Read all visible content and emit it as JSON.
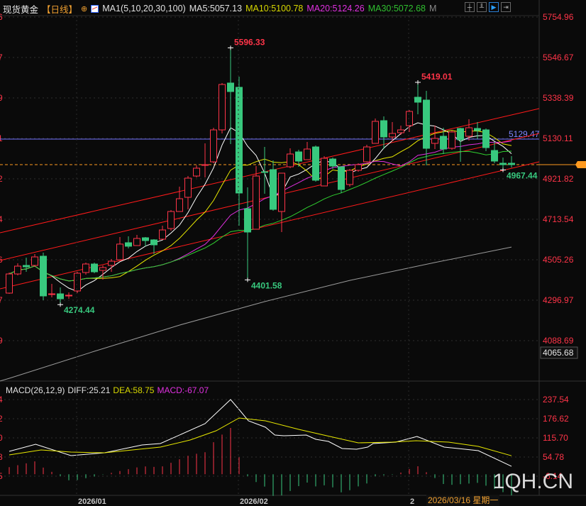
{
  "header": {
    "symbol": "现货黄金",
    "period": "【日线】",
    "indicator": "MA1(5,10,20,30,100)",
    "ma5": "MA5:5057.13",
    "ma10": "MA10:5100.78",
    "ma20": "MA20:5124.26",
    "ma30": "MA30:5072.68",
    "ma100_short": "M",
    "tools": [
      "crosshair-icon",
      "interval-icon",
      "play-icon",
      "exit-icon"
    ]
  },
  "macd_header": {
    "label": "MACD(26,12,9)",
    "diff": "DIFF:25.21",
    "dea": "DEA:58.75",
    "macd": "MACD:-67.07"
  },
  "colors": {
    "up": "#ff3448",
    "down": "#38c87e",
    "ma5": "#ffffff",
    "ma10": "#e8e800",
    "ma20": "#e030e0",
    "ma30": "#30d030",
    "ma100": "#9a9a9a",
    "trendline": "#ff1a1a",
    "hline": "#7070ff",
    "current_price": "#ff9a20",
    "axis_text": "#ff3448"
  },
  "watermark": "1QH.CN",
  "crosshair_date": "2026/03/16 星期一",
  "chart_data": [
    {
      "type": "candlestick",
      "title": "现货黄金 日线",
      "price_axis_labels": [
        "5754.96",
        "5546.67",
        "5338.39",
        "5130.11",
        "4921.82",
        "4713.54",
        "4505.26",
        "4296.97",
        "4088.69"
      ],
      "price_axis_min_box": "4065.68",
      "ylim": [
        4065.68,
        5754.96
      ],
      "left_axis_fragments": [
        "6",
        "7",
        "9",
        "1",
        "2",
        "4",
        "6",
        "7",
        "9"
      ],
      "date_axis_labels": [
        {
          "label": "2026/01",
          "index": 9
        },
        {
          "label": "2026/02",
          "index": 28
        },
        {
          "label": "2",
          "index": 48
        }
      ],
      "ohlc": [
        [
          4333.7,
          4439.7,
          4330.0,
          4432.3
        ],
        [
          4432.3,
          4487.1,
          4425.0,
          4472.5
        ],
        [
          4476.2,
          4516.2,
          4443.3,
          4468.9
        ],
        [
          4476.2,
          4534.6,
          4468.9,
          4520.0
        ],
        [
          4523.7,
          4541.9,
          4297.2,
          4319.1
        ],
        [
          4326.4,
          4381.2,
          4311.7,
          4330.0
        ],
        [
          4330.0,
          4362.9,
          4274.44,
          4304.4
        ],
        [
          4319.1,
          4337.4,
          4304.4,
          4322.8
        ],
        [
          4344.7,
          4443.3,
          4333.7,
          4436.0
        ],
        [
          4439.7,
          4490.8,
          4428.7,
          4483.5
        ],
        [
          4483.5,
          4490.8,
          4436.0,
          4443.3
        ],
        [
          4450.6,
          4476.2,
          4403.1,
          4465.2
        ],
        [
          4476.2,
          4509.1,
          4443.3,
          4498.1
        ],
        [
          4505.4,
          4622.3,
          4505.4,
          4586.0
        ],
        [
          4593.1,
          4626.0,
          4563.9,
          4574.9
        ],
        [
          4578.5,
          4633.3,
          4578.5,
          4615.0
        ],
        [
          4618.7,
          4622.3,
          4574.9,
          4604.1
        ],
        [
          4607.7,
          4611.4,
          4534.6,
          4582.2
        ],
        [
          4611.4,
          4680.8,
          4607.7,
          4658.9
        ],
        [
          4666.2,
          4761.2,
          4655.2,
          4753.9
        ],
        [
          4753.9,
          4881.7,
          4753.9,
          4819.6
        ],
        [
          4826.9,
          4936.5,
          4764.8,
          4925.6
        ],
        [
          4936.5,
          4991.3,
          4929.2,
          4976.8
        ],
        [
          4991.3,
          5104.6,
          4929.2,
          4995.0
        ],
        [
          5009.6,
          5185.0,
          5002.3,
          5174.0
        ],
        [
          5174.0,
          5415.2,
          5155.7,
          5407.8
        ],
        [
          5415.2,
          5596.33,
          5100.9,
          5371.3
        ],
        [
          5393.2,
          5448.0,
          4680.8,
          4849.0
        ],
        [
          4768.5,
          4878.1,
          4401.58,
          4648.0
        ],
        [
          4662.5,
          4987.7,
          4662.5,
          4936.5
        ],
        [
          4958.5,
          5086.3,
          4845.2,
          4954.8
        ],
        [
          4969.4,
          5016.9,
          4757.5,
          4764.8
        ],
        [
          4753.9,
          4951.2,
          4648.0,
          4951.2
        ],
        [
          4984.0,
          5079.1,
          4976.8,
          5049.8
        ],
        [
          5060.7,
          5071.7,
          4984.0,
          5013.3
        ],
        [
          5020.6,
          5111.9,
          5020.6,
          5075.4
        ],
        [
          5086.3,
          5093.6,
          4907.3,
          4914.7
        ],
        [
          4885.4,
          5038.9,
          4885.4,
          5027.9
        ],
        [
          5024.2,
          5031.6,
          4973.1,
          4987.7
        ],
        [
          4984.0,
          4984.0,
          4848.9,
          4867.1
        ],
        [
          4892.7,
          4973.1,
          4881.7,
          4965.8
        ],
        [
          4965.8,
          5002.3,
          4958.5,
          4995.0
        ],
        [
          5009.6,
          5097.3,
          5005.9,
          5086.3
        ],
        [
          5104.6,
          5232.5,
          5104.6,
          5217.9
        ],
        [
          5221.5,
          5243.4,
          5075.4,
          5137.5
        ],
        [
          5137.5,
          5214.2,
          5115.5,
          5155.7
        ],
        [
          5159.4,
          5195.9,
          5148.4,
          5174.0
        ],
        [
          5195.9,
          5276.3,
          5163.1,
          5269.0
        ],
        [
          5342.1,
          5419.01,
          5254.4,
          5316.5
        ],
        [
          5327.5,
          5375.0,
          4991.3,
          5079.1
        ],
        [
          5104.6,
          5195.9,
          5075.4,
          5130.2
        ],
        [
          5141.2,
          5185.0,
          5049.8,
          5075.4
        ],
        [
          5079.1,
          5170.4,
          5071.7,
          5163.1
        ],
        [
          5181.3,
          5185.0,
          5009.6,
          5122.9
        ],
        [
          5141.2,
          5228.8,
          5119.2,
          5185.0
        ],
        [
          5181.3,
          5214.2,
          5126.5,
          5170.4
        ],
        [
          5174.0,
          5181.3,
          5064.4,
          5082.7
        ],
        [
          5068.0,
          5111.9,
          5002.3,
          5013.3
        ],
        [
          5002.3,
          5031.6,
          4967.44,
          4995.0
        ],
        [
          5002.3,
          5038.9,
          4980.1,
          4995.0
        ]
      ],
      "ma_periods": [
        5,
        10,
        20,
        30
      ],
      "ma100": [
        [
          0,
          3895
        ],
        [
          10,
          4034
        ],
        [
          20,
          4169
        ],
        [
          30,
          4290
        ],
        [
          40,
          4399
        ],
        [
          50,
          4491
        ],
        [
          59,
          4571
        ]
      ],
      "trendlines": [
        [
          [
            -1.08,
            4644.2
          ],
          [
            62.25,
            5283.6
          ]
        ],
        [
          [
            -1.08,
            4501.8
          ],
          [
            62.25,
            5155.7
          ]
        ],
        [
          [
            -1.08,
            4355.7
          ],
          [
            62.25,
            5009.6
          ]
        ]
      ],
      "horizontal_line": {
        "price": 5126.5,
        "label": "5129.47"
      },
      "current_price": 4995.0,
      "annotations": [
        {
          "index": 26,
          "price": 5596.33,
          "text": "5596.33",
          "kind": "high"
        },
        {
          "index": 48,
          "price": 5419.01,
          "text": "5419.01",
          "kind": "high"
        },
        {
          "index": 28,
          "price": 4401.58,
          "text": "4401.58",
          "kind": "low"
        },
        {
          "index": 6,
          "price": 4274.44,
          "text": "4274.44",
          "kind": "low"
        },
        {
          "index": 58,
          "price": 4967.44,
          "text": "4967.44",
          "kind": "low"
        }
      ]
    },
    {
      "type": "line",
      "title": "MACD(26,12,9)",
      "axis_labels": [
        "237.54",
        "176.62",
        "115.70",
        "54.78",
        "-6.14"
      ],
      "ylim": [
        -6.14,
        237.54
      ],
      "left_axis_fragments": [
        "4",
        "2",
        "0",
        "8",
        "5"
      ],
      "series": [
        {
          "name": "DIFF",
          "points": [
            [
              0,
              72.8
            ],
            [
              3.1,
              95.4
            ],
            [
              7.25,
              59.3
            ],
            [
              11.2,
              68.3
            ],
            [
              15.6,
              93.1
            ],
            [
              17.75,
              97.6
            ],
            [
              23,
              160.8
            ],
            [
              26,
              237.5
            ],
            [
              27,
              205.9
            ],
            [
              28.1,
              169.8
            ],
            [
              30.1,
              149.5
            ],
            [
              31.2,
              124.7
            ],
            [
              32.25,
              122.5
            ],
            [
              34.9,
              124.7
            ],
            [
              36,
              111.2
            ],
            [
              37.5,
              104.4
            ],
            [
              39.1,
              81.9
            ],
            [
              40.8,
              79.6
            ],
            [
              42.1,
              86.4
            ],
            [
              42.75,
              97.6
            ],
            [
              45.4,
              102.2
            ],
            [
              47.9,
              120.2
            ],
            [
              51.1,
              86.4
            ],
            [
              55.1,
              75.1
            ],
            [
              59,
              25.21
            ]
          ]
        },
        {
          "name": "DEA",
          "points": [
            [
              0,
              61.5
            ],
            [
              3.75,
              77.4
            ],
            [
              7.25,
              70.6
            ],
            [
              11.2,
              68.3
            ],
            [
              17.75,
              86.4
            ],
            [
              21.25,
              108.9
            ],
            [
              24.3,
              138.3
            ],
            [
              27,
              178.9
            ],
            [
              30.1,
              169.8
            ],
            [
              34,
              142.8
            ],
            [
              38.4,
              115.7
            ],
            [
              41,
              99.9
            ],
            [
              45,
              102.2
            ],
            [
              47.8,
              106.7
            ],
            [
              51.6,
              102.2
            ],
            [
              55.1,
              88.7
            ],
            [
              59,
              58.75
            ]
          ]
        },
        {
          "name": "MACD",
          "histogram": "2*(DIFF-DEA)"
        }
      ]
    }
  ]
}
